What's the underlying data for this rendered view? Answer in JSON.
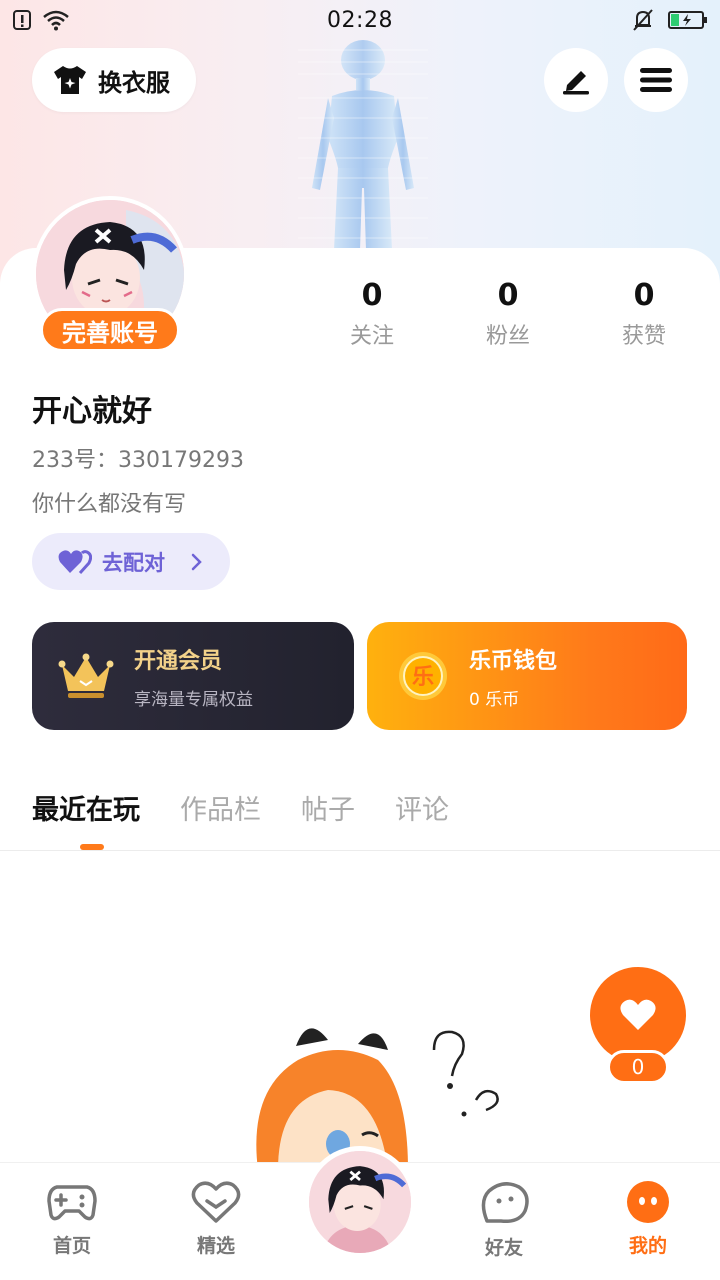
{
  "status_bar": {
    "time": "02:28"
  },
  "header": {
    "outfit_label": "换衣服"
  },
  "profile": {
    "complete_badge": "完善账号",
    "stats": [
      {
        "value": "0",
        "label": "关注"
      },
      {
        "value": "0",
        "label": "粉丝"
      },
      {
        "value": "0",
        "label": "获赞"
      }
    ],
    "nickname": "开心就好",
    "uid": "233号：330179293",
    "bio": "你什么都没有写",
    "match_label": "去配对"
  },
  "cards": {
    "vip": {
      "title": "开通会员",
      "subtitle": "享海量专属权益"
    },
    "wallet": {
      "title": "乐币钱包",
      "subtitle": "0 乐币",
      "coin_glyph": "乐"
    }
  },
  "tabs": [
    "最近在玩",
    "作品栏",
    "帖子",
    "评论"
  ],
  "like": {
    "count": "0"
  },
  "bottom_nav": [
    {
      "label": "首页"
    },
    {
      "label": "精选"
    },
    {
      "label": "好友"
    },
    {
      "label": "我的"
    }
  ],
  "colors": {
    "accent": "#ff6e14",
    "purple": "#6e62d6",
    "gold": "#f3d28a"
  },
  "icons": [
    "shirt-icon",
    "pencil-icon",
    "menu-icon",
    "heart-icon",
    "gamepad-icon",
    "heart-outline-icon",
    "bubble-icon",
    "face-icon",
    "crown-icon",
    "coin-icon"
  ]
}
